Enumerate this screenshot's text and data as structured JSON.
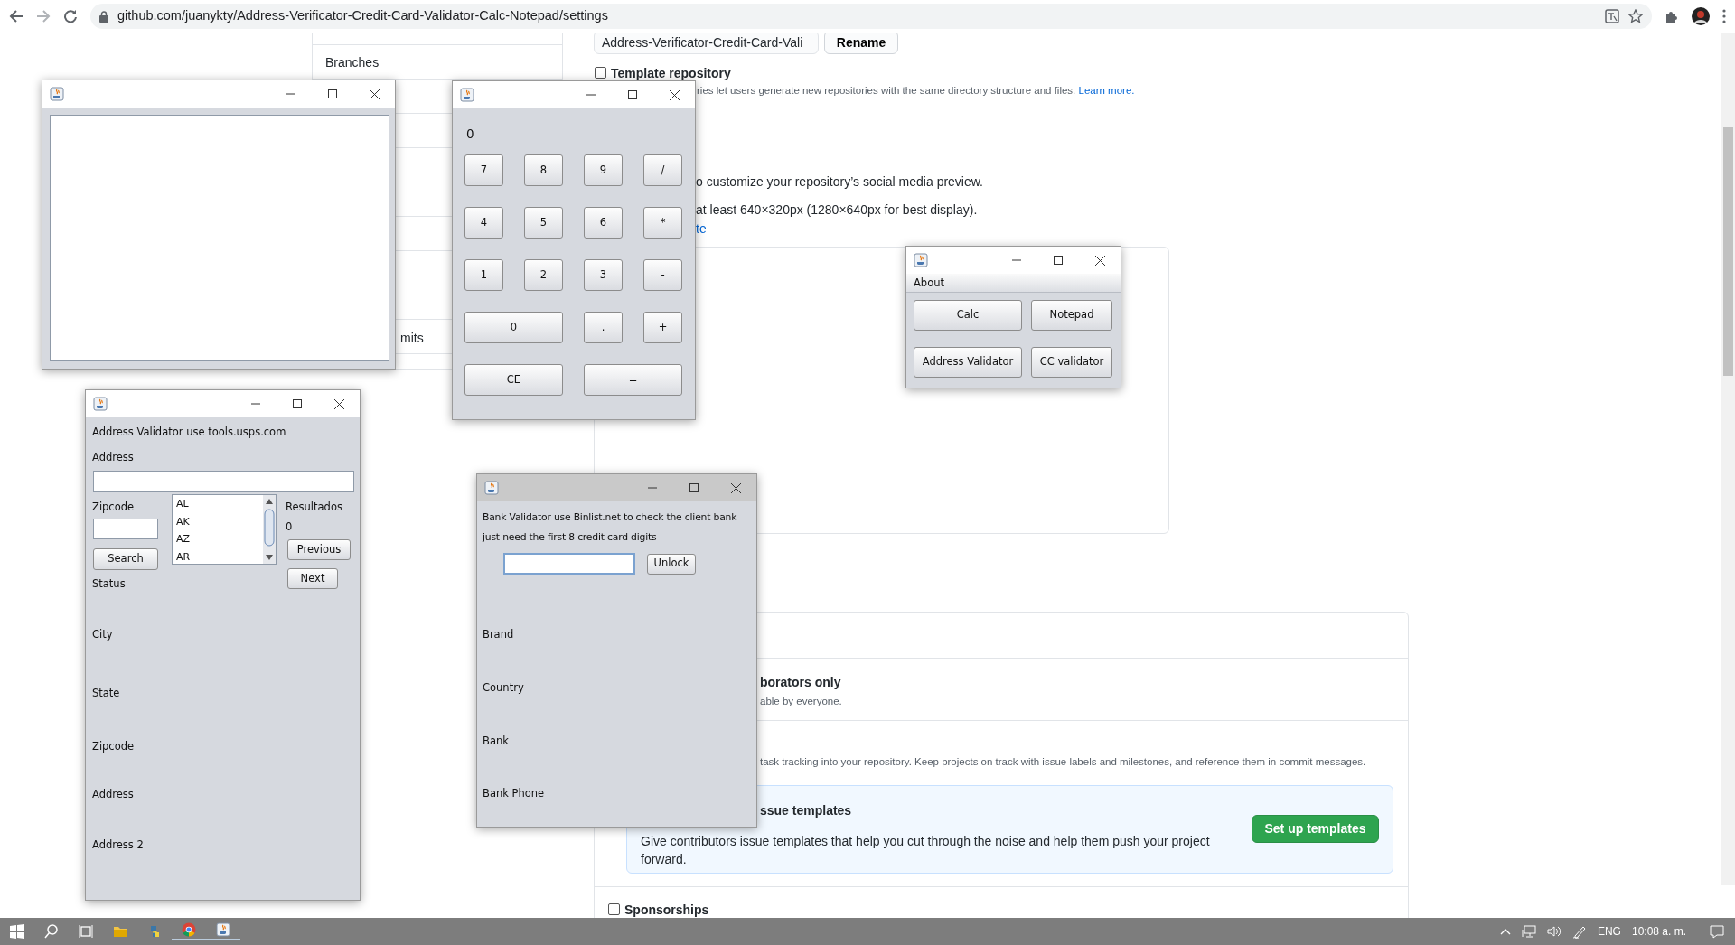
{
  "browser": {
    "url": "github.com/juanykty/Address-Verificator-Credit-Card-Validator-Calc-Notepad/settings"
  },
  "page": {
    "sidebar_items": [
      "Branches",
      "mits"
    ],
    "repo_name": {
      "value": "Address-Verificator-Credit-Card-Vali"
    },
    "rename_button": "Rename",
    "template_repository": {
      "label": "Template repository",
      "checked": false,
      "description": "ries let users generate new repositories with the same directory structure and files.",
      "link": "Learn more."
    },
    "social_preview": {
      "lines": [
        "o customize your repository’s social media preview.",
        "at least 640×320px (1280×640px for best display)."
      ],
      "link": "te"
    },
    "features": {
      "collaborators": {
        "title": "borators only",
        "description": "able by everyone."
      },
      "issues_description": "task tracking into your repository. Keep projects on track with issue labels and milestones, and reference them in commit messages.",
      "templates": {
        "title": "ssue templates",
        "description": "Give contributors issue templates that help you cut through the noise and help them push your project forward.",
        "button": "Set up templates"
      },
      "sponsorships": {
        "label": "Sponsorships",
        "checked": false
      }
    }
  },
  "windows": [
    {
      "kind": "notepad",
      "focused": false
    },
    {
      "kind": "calc",
      "focused": false,
      "display": "0",
      "keys": [
        {
          "label": "7",
          "wide": false
        },
        {
          "label": "8",
          "wide": false
        },
        {
          "label": "9",
          "wide": false
        },
        {
          "label": "/",
          "wide": false
        },
        {
          "label": "4",
          "wide": false
        },
        {
          "label": "5",
          "wide": false
        },
        {
          "label": "6",
          "wide": false
        },
        {
          "label": "*",
          "wide": false
        },
        {
          "label": "1",
          "wide": false
        },
        {
          "label": "2",
          "wide": false
        },
        {
          "label": "3",
          "wide": false
        },
        {
          "label": "-",
          "wide": false
        },
        {
          "label": "0",
          "wide": true
        },
        {
          "label": ".",
          "wide": false
        },
        {
          "label": "+",
          "wide": false
        },
        {
          "label": "CE",
          "wide": true
        },
        {
          "label": "=",
          "wide": true
        }
      ]
    },
    {
      "kind": "menu",
      "focused": false,
      "menu": [
        "About"
      ],
      "buttons": [
        "Calc",
        "Notepad",
        "Address Validator",
        "CC validator"
      ]
    },
    {
      "kind": "address",
      "focused": false,
      "heading": "Address Validator use tools.usps.com",
      "address_label": "Address",
      "zipcode_label": "Zipcode",
      "search_button": "Search",
      "states": [
        "AL",
        "AK",
        "AZ",
        "AR"
      ],
      "results_label": "Resultados",
      "results_count": "0",
      "previous_button": "Previous",
      "next_button": "Next",
      "fields": [
        "Status",
        "City",
        "State",
        "Zipcode",
        "Address",
        "Address 2"
      ]
    },
    {
      "kind": "bank",
      "focused": true,
      "heading_lines": [
        "Bank Validator use Binlist.net to check the client bank",
        "just need the first 8 credit card digits"
      ],
      "unlock_button": "Unlock",
      "fields": [
        "Brand",
        "Country",
        "Bank",
        "Bank Phone"
      ]
    }
  ],
  "taskbar": {
    "language": "ENG",
    "time": "10:08 a. m."
  }
}
